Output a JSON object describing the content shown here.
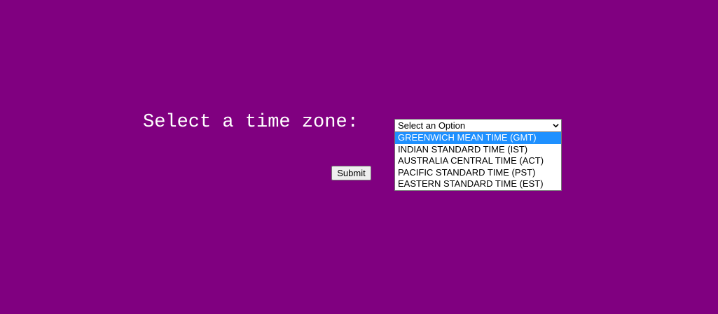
{
  "form": {
    "label": "Select a time zone:",
    "select": {
      "value": "Select an Option",
      "icon": "chevron-down-icon",
      "options": [
        "GREENWICH MEAN TIME (GMT)",
        "INDIAN STANDARD TIME (IST)",
        "AUSTRALIA CENTRAL TIME (ACT)",
        "PACIFIC STANDARD TIME (PST)",
        "EASTERN STANDARD TIME (EST)"
      ],
      "highlighted_index": 0
    },
    "submit_label": "Submit"
  },
  "colors": {
    "background": "#800080",
    "highlight": "#1e90ff",
    "text": "#ffffff"
  }
}
